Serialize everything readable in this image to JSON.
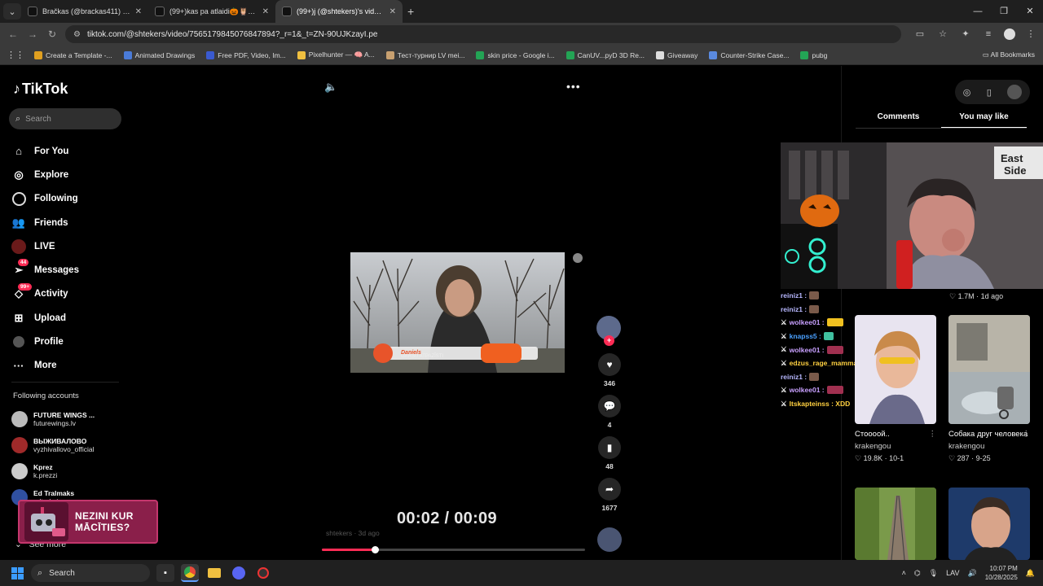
{
  "browser": {
    "tabs": [
      {
        "label": "Bračkas (@brackas411) | TikTok",
        "active": false
      },
      {
        "label": "(99+)kas pa atlaidi🎃🦉🎃 #p",
        "active": false
      },
      {
        "label": "(99+)j (@shtekers)'s videos with",
        "active": true
      }
    ],
    "url": "tiktok.com/@shtekers/video/7565179845076847894?_r=1&_t=ZN-90UJKzayI.pe",
    "bookmarks": [
      {
        "label": "Create a Template -...",
        "color": "#e0a020"
      },
      {
        "label": "Animated Drawings",
        "color": "#4a7bd8"
      },
      {
        "label": "Free PDF, Video, Im...",
        "color": "#3a5ad0"
      },
      {
        "label": "Pixelhunter — 🧠 A...",
        "color": "#f0c040"
      },
      {
        "label": "Тест-турнир LV mei...",
        "color": "#c8a070"
      },
      {
        "label": "skin price - Google i...",
        "color": "#23a455"
      },
      {
        "label": "CanUV...pyD 3D Re...",
        "color": "#23a455"
      },
      {
        "label": "Giveaway",
        "color": "#ddd"
      },
      {
        "label": "Counter-Strike Case...",
        "color": "#5a8ae0"
      },
      {
        "label": "pubg",
        "color": "#23a455"
      }
    ],
    "all_bookmarks": "All Bookmarks"
  },
  "sidebar": {
    "logo": "TikTok",
    "search_placeholder": "Search",
    "nav": [
      {
        "label": "For You",
        "icon": "home-icon"
      },
      {
        "label": "Explore",
        "icon": "compass-icon"
      },
      {
        "label": "Following",
        "icon": "following-icon"
      },
      {
        "label": "Friends",
        "icon": "friends-icon"
      },
      {
        "label": "LIVE",
        "icon": "live-icon"
      },
      {
        "label": "Messages",
        "icon": "messages-icon",
        "badge": "44"
      },
      {
        "label": "Activity",
        "icon": "activity-icon",
        "badge": "99+"
      },
      {
        "label": "Upload",
        "icon": "upload-icon"
      },
      {
        "label": "Profile",
        "icon": "profile-icon"
      },
      {
        "label": "More",
        "icon": "more-icon"
      }
    ],
    "following_title": "Following accounts",
    "following": [
      {
        "name": "FUTURE WINGS ...",
        "handle": "futurewings.lv",
        "color": "#bbbbbb"
      },
      {
        "name": "ВЫЖИВАЛОВО",
        "handle": "vyzhivallovo_official",
        "color": "#a02a2a"
      },
      {
        "name": "Kprez",
        "handle": "k.prezzi",
        "color": "#cccccc"
      },
      {
        "name": "Ed Tralmaks",
        "handle": "edtralmix",
        "color": "#3050a0"
      }
    ],
    "see_more": "See more",
    "ad_text_line1": "NEZINI KUR",
    "ad_text_line2": "MĀCĪTIES?"
  },
  "player": {
    "time": "00:02 / 00:09",
    "author_faint": "shtekers · 3d ago",
    "progress": 0.2,
    "caption_name": "Daniels",
    "caption_sub": "GARŠU ATPAZĪSTI",
    "likes": "346",
    "comments": "4",
    "saves": "48",
    "shares": "1677"
  },
  "right_panel": {
    "tab_comments": "Comments",
    "tab_you_may_like": "You may like",
    "top_stats": "♡ 1.7M · 1d ago",
    "chat": [
      {
        "user": "reiniz1 :",
        "color": "#b8b8ff"
      },
      {
        "user": "reiniz1 :",
        "color": "#b8b8ff"
      },
      {
        "user": "wolkee01 :",
        "color": "#c8a0ff"
      },
      {
        "user": "knapss5 :",
        "color": "#4aa0ff"
      },
      {
        "user": "wolkee01 :",
        "color": "#c8a0ff"
      },
      {
        "user": "edzus_rage_mamma :",
        "color": "#ffd040"
      },
      {
        "user": "reiniz1 :",
        "color": "#b8b8ff"
      },
      {
        "user": "wolkee01 :",
        "color": "#c8a0ff"
      },
      {
        "user": "Itskapteinss : XDD",
        "color": "#ffd040"
      }
    ],
    "cards": [
      {
        "title": "Стоооой..",
        "author": "krakengou",
        "stats": "♡ 19.8K · 10-1"
      },
      {
        "title": "Собака друг человека",
        "author": "krakengou",
        "stats": "♡ 287 · 9-25"
      }
    ]
  },
  "taskbar": {
    "search": "Search",
    "lang": "LAV",
    "time": "10:07 PM",
    "date": "10/28/2025"
  }
}
